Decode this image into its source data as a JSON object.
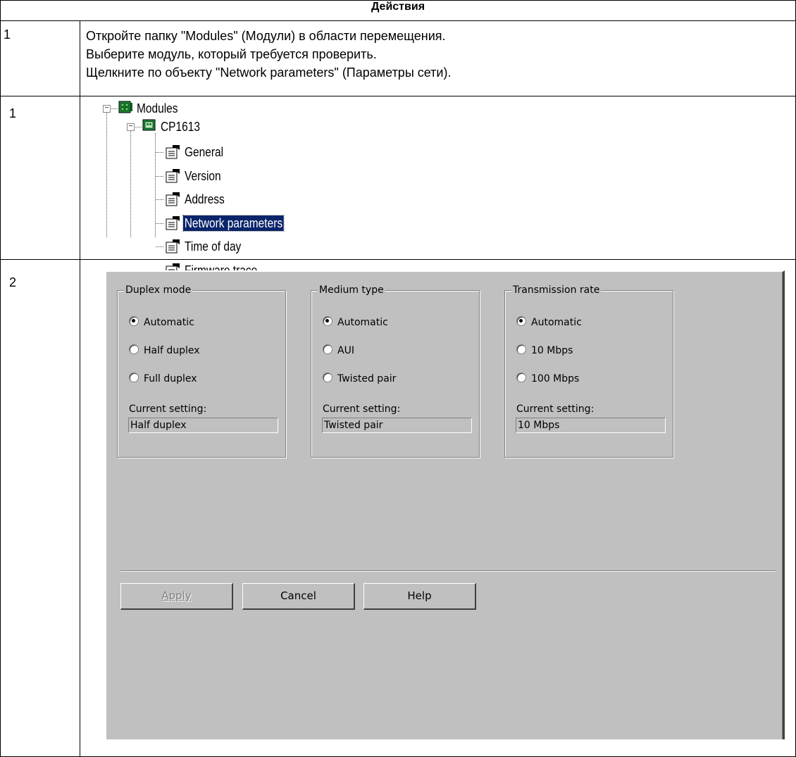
{
  "table": {
    "header": "Действия",
    "rows": [
      {
        "num": "1",
        "steps": [
          "Откройте папку \"Modules\" (Модули) в области перемещения.",
          "Выберите модуль, который требуется проверить.",
          "Щелкните по объекту \"Network parameters\" (Параметры сети)."
        ]
      },
      {
        "num": "1"
      },
      {
        "num": "2"
      }
    ]
  },
  "tree": {
    "root": "Modules",
    "module": "CP1613",
    "items": [
      "General",
      "Version",
      "Address",
      "Network parameters",
      "Time of day",
      "Firmware trace"
    ],
    "selected": "Network parameters"
  },
  "dialog": {
    "groups": [
      {
        "title": "Duplex mode",
        "options": [
          "Automatic",
          "Half duplex",
          "Full duplex"
        ],
        "selected": 0,
        "current_label": "Current setting:",
        "current_value": "Half duplex"
      },
      {
        "title": "Medium type",
        "options": [
          "Automatic",
          "AUI",
          "Twisted pair"
        ],
        "selected": 0,
        "current_label": "Current setting:",
        "current_value": "Twisted pair"
      },
      {
        "title": "Transmission rate",
        "options": [
          "Automatic",
          "10 Mbps",
          "100 Mbps"
        ],
        "selected": 0,
        "current_label": "Current setting:",
        "current_value": "10 Mbps"
      }
    ],
    "buttons": {
      "apply": "Apply",
      "cancel": "Cancel",
      "help": "Help"
    }
  }
}
